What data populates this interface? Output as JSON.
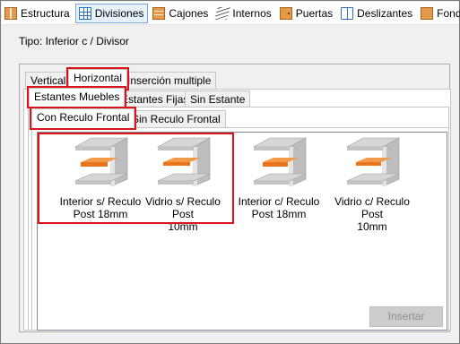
{
  "toolbar": {
    "items": [
      {
        "label": "Estructura",
        "icon": "cabinet-icon"
      },
      {
        "label": "Divisiones",
        "icon": "grid-icon",
        "active": true
      },
      {
        "label": "Cajones",
        "icon": "drawers-icon"
      },
      {
        "label": "Internos",
        "icon": "internals-icon"
      },
      {
        "label": "Puertas",
        "icon": "door-icon"
      },
      {
        "label": "Deslizantes",
        "icon": "sliding-icon"
      },
      {
        "label": "Fondos",
        "icon": "back-panel-icon"
      }
    ]
  },
  "tipo": "Tipo: Inferior c / Divisor",
  "tabs_level1": [
    "Vertical",
    "Horizontal",
    "Inserción multiple"
  ],
  "tabs_level2": [
    "Estantes Muebles",
    "Estantes Fijas",
    "Sin Estante"
  ],
  "tabs_level3": [
    "Con Reculo Frontal",
    "Sin Reculo Frontal"
  ],
  "items": [
    {
      "line1": "Interior s/ Reculo",
      "line2": "Post 18mm"
    },
    {
      "line1": "Vidrio s/ Reculo Post",
      "line2": "10mm"
    },
    {
      "line1": "Interior c/ Reculo",
      "line2": "Post 18mm"
    },
    {
      "line1": "Vidrio c/ Reculo Post",
      "line2": "10mm"
    }
  ],
  "insert_button": "Insertar",
  "colors": {
    "highlight": "#d9141a",
    "shelf": "#e8741c",
    "active_toolbar": "#e5f1fb"
  }
}
